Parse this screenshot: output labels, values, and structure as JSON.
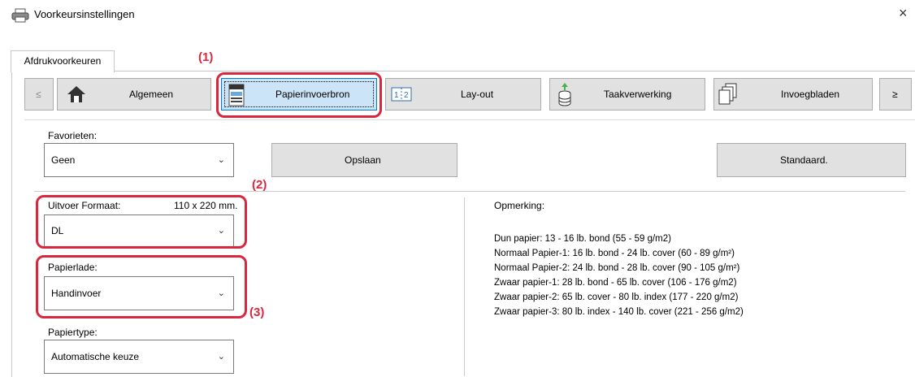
{
  "window": {
    "title": "Voorkeursinstellingen",
    "close_glyph": "×"
  },
  "tab": {
    "label": "Afdrukvoorkeuren"
  },
  "nav": {
    "prev": "≤",
    "next": "≥",
    "buttons": [
      {
        "label": "Algemeen",
        "icon": "home-icon"
      },
      {
        "label": "Papierinvoerbron",
        "icon": "printer-tray-icon",
        "selected": true
      },
      {
        "label": "Lay-out",
        "icon": "page-layout-icon"
      },
      {
        "label": "Taakverwerking",
        "icon": "job-handling-icon"
      },
      {
        "label": "Invoegbladen",
        "icon": "insert-sheets-icon"
      }
    ]
  },
  "favorites": {
    "label": "Favorieten:",
    "value": "Geen",
    "save": "Opslaan",
    "default": "Standaard."
  },
  "output": {
    "label": "Uitvoer Formaat:",
    "size": "110 x 220 mm.",
    "value": "DL"
  },
  "tray": {
    "label": "Papierlade:",
    "value": "Handinvoer"
  },
  "papertype": {
    "label": "Papiertype:",
    "value": "Automatische keuze"
  },
  "remark": {
    "title": "Opmerking:",
    "lines": [
      "Dun papier: 13 - 16 lb. bond (55 - 59 g/m2)",
      "Normaal Papier-1: 16 lb. bond - 24 lb. cover (60 - 89 g/m²)",
      "Normaal Papier-2: 24 lb. bond - 28 lb. cover (90 - 105 g/m²)",
      "Zwaar papier-1: 28 lb. bond - 65 lb. cover (106 - 176 g/m2)",
      "Zwaar papier-2: 65 lb. cover - 80 lb. index (177 - 220 g/m2)",
      "Zwaar papier-3: 80 lb. index - 140 lb. cover (221 - 256 g/m2)"
    ]
  },
  "callouts": {
    "c1": "(1)",
    "c2": "(2)",
    "c3": "(3)"
  },
  "colors": {
    "callout": "#d8273f",
    "selected_bg": "#cce4f7",
    "selected_border": "#0078d7"
  }
}
